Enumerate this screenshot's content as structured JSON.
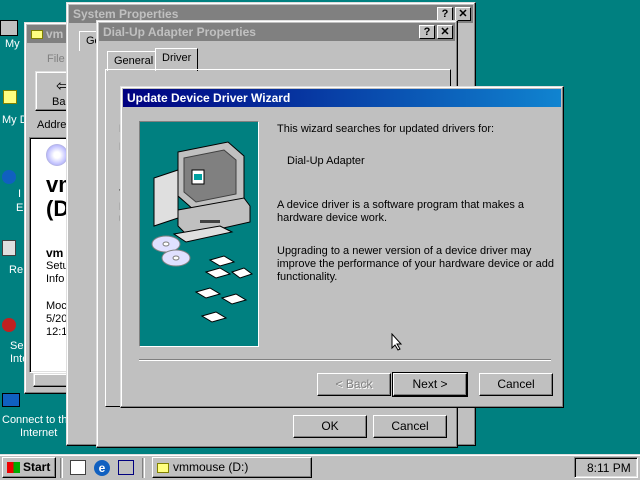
{
  "desktop": {
    "icons": [
      {
        "label": "My"
      },
      {
        "label": "My D"
      },
      {
        "label": "I"
      },
      {
        "label": "E"
      },
      {
        "label": "Re"
      },
      {
        "label": "Se"
      },
      {
        "label": "Inte"
      },
      {
        "label": "Connect to th"
      },
      {
        "label": "Internet"
      }
    ]
  },
  "vm_window": {
    "title": "vm",
    "menu_file": "File",
    "back_label": "Ba",
    "address_label": "Addre",
    "content_big1": "vm",
    "content_big2": "(D",
    "lines": [
      "vm",
      "Setu",
      "Info",
      "Moc",
      "5/20",
      "12:1"
    ]
  },
  "system_properties": {
    "title": "System Properties",
    "help": "?",
    "close": "✕",
    "tab_general_partial": "Ge"
  },
  "dialup_props": {
    "title": "Dial-Up Adapter Properties",
    "help": "?",
    "close": "✕",
    "tab_general": "General",
    "tab_driver": "Driver",
    "left_letters": [
      "F",
      "D",
      "T",
      "D",
      "U"
    ],
    "ok": "OK",
    "cancel": "Cancel"
  },
  "wizard": {
    "title": "Update Device Driver Wizard",
    "line1": "This wizard searches for updated drivers for:",
    "device": "Dial-Up Adapter",
    "para1a": "A device driver is a software program that makes a",
    "para1b": "hardware device work.",
    "para2a": "Upgrading to a newer version of a device driver may",
    "para2b": "improve the performance of your hardware device or add",
    "para2c": "functionality.",
    "back": "< Back",
    "next": "Next >",
    "cancel": "Cancel"
  },
  "taskbar": {
    "start": "Start",
    "task": "vmmouse (D:)",
    "clock": "8:11 PM"
  },
  "colors": {
    "desktop": "#008080",
    "title_active": "#000080",
    "title_inactive": "#808080",
    "face": "#c0c0c0"
  }
}
